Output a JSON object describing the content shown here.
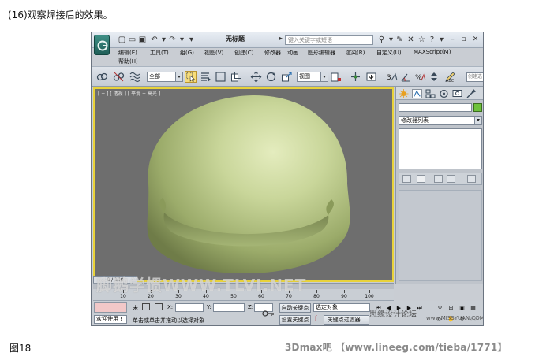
{
  "captions": {
    "top": "(16)观察焊接后的效果。",
    "bottom": "图18",
    "footer_credit": "3Dmax吧 【www.lineeg.com/tieba/1771】"
  },
  "window": {
    "title": "无标题",
    "search_placeholder": "键入关键字或短语"
  },
  "menu": {
    "items": [
      "编辑(E)",
      "工具(T)",
      "组(G)",
      "视图(V)",
      "创建(C)",
      "修改器",
      "动画",
      "图形编辑器",
      "渲染(R)",
      "自定义(U)",
      "MAXScript(M)",
      "帮助(H)"
    ]
  },
  "toolbar": {
    "selection_filter": "全部",
    "reference_coord": "视图",
    "named_selection": "创建选"
  },
  "viewport": {
    "label": "[ + ] [ 透视 ] [ 平滑 + 高光 ]",
    "accent_color": "#e8d23a",
    "object_color": "#b5c58a"
  },
  "command_panel": {
    "modifier_list": "修改器列表"
  },
  "timeline": {
    "slider_text": "0 / 100",
    "ticks": [
      "10",
      "20",
      "30",
      "40",
      "50",
      "60",
      "70",
      "80",
      "90",
      "100"
    ]
  },
  "status": {
    "selected": "未",
    "x_label": "X:",
    "y_label": "Y:",
    "z_label": "Z:",
    "welcome": "欢迎使用 !",
    "prompt": "单击或单击并拖动以选择对象",
    "auto_key": "自动关键点",
    "set_key": "设置关键点",
    "selected_object": "选定对象",
    "key_filters": "关键点过滤器..."
  },
  "watermarks": {
    "main": "脚鹅学惯WWW.TLVI.NET",
    "secondary": "思缘设计论坛",
    "url": "www.MISSYUAN.COM"
  }
}
